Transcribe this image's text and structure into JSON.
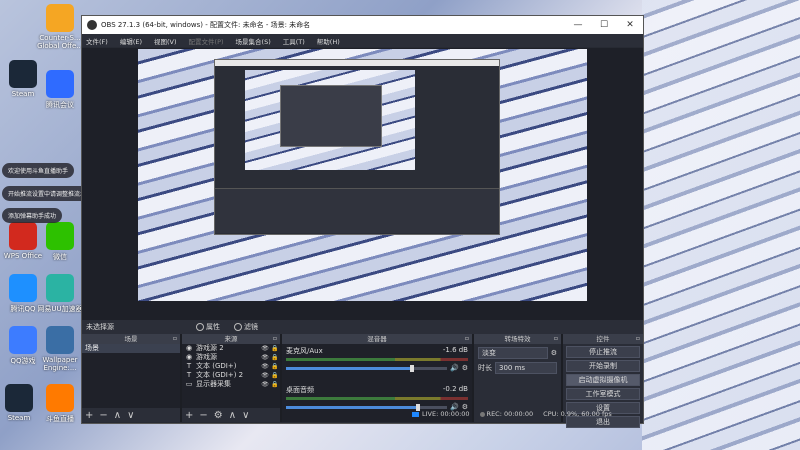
{
  "desktop": {
    "icons": [
      {
        "label": "Counter-S... Global Offe...",
        "color": "#f5a623"
      },
      {
        "label": "Steam",
        "color": "#1b2838"
      },
      {
        "label": "腾讯会议",
        "color": "#2f6bff"
      },
      {
        "label": "WPS Office",
        "color": "#d2291e"
      },
      {
        "label": "微信",
        "color": "#2dc100"
      },
      {
        "label": "腾讯QQ",
        "color": "#1e90ff"
      },
      {
        "label": "网易UU加速器",
        "color": "#2bb3a3"
      },
      {
        "label": "QQ游戏",
        "color": "#3d7cff"
      },
      {
        "label": "Wallpaper Engine:...",
        "color": "#3a6ea5"
      },
      {
        "label": "Steam",
        "color": "#1b2838"
      },
      {
        "label": "斗鱼直播",
        "color": "#ff7a00"
      }
    ],
    "notices": [
      "欢迎使用斗鱼直播助手",
      "开始推流设置中请调整推流地址",
      "添加弹幕助手成功"
    ]
  },
  "window": {
    "title": "OBS 27.1.3 (64-bit, windows) - 配置文件: 未命名 - 场景: 未命名",
    "minimize": "—",
    "maximize": "☐",
    "close": "✕"
  },
  "menu": [
    "文件(F)",
    "编辑(E)",
    "视图(V)",
    "配置文件(P)",
    "场景集合(S)",
    "工具(T)",
    "帮助(H)"
  ],
  "toolbar": {
    "scene_label": "未选择源",
    "properties": "属性",
    "filters": "滤镜"
  },
  "docks": {
    "scenes": {
      "title": "场景",
      "items": [
        "场景"
      ]
    },
    "sources": {
      "title": "来源",
      "items": [
        {
          "icon": "◉",
          "name": "游戏源 2"
        },
        {
          "icon": "◉",
          "name": "游戏源"
        },
        {
          "icon": "T",
          "name": "文本 (GDI+)"
        },
        {
          "icon": "T",
          "name": "文本 (GDI+) 2"
        },
        {
          "icon": "▭",
          "name": "显示器采集"
        }
      ]
    },
    "mixer": {
      "title": "混音器",
      "tracks": [
        {
          "name": "麦克风/Aux",
          "db": "-1.6 dB",
          "level": 0.78
        },
        {
          "name": "桌面音频",
          "db": "-0.2 dB",
          "level": 0.82
        }
      ]
    },
    "transitions": {
      "title": "转场特效",
      "type": "淡变",
      "duration_label": "时长",
      "duration": "300 ms"
    },
    "controls": {
      "title": "控件",
      "buttons": [
        "停止推流",
        "开始录制",
        "启动虚拟摄像机",
        "工作室模式",
        "设置",
        "退出"
      ]
    }
  },
  "status": {
    "live": "LIVE: 00:00:00",
    "rec": "REC: 00:00:00",
    "cpu": "CPU: 0.9%, 60.00 fps"
  }
}
